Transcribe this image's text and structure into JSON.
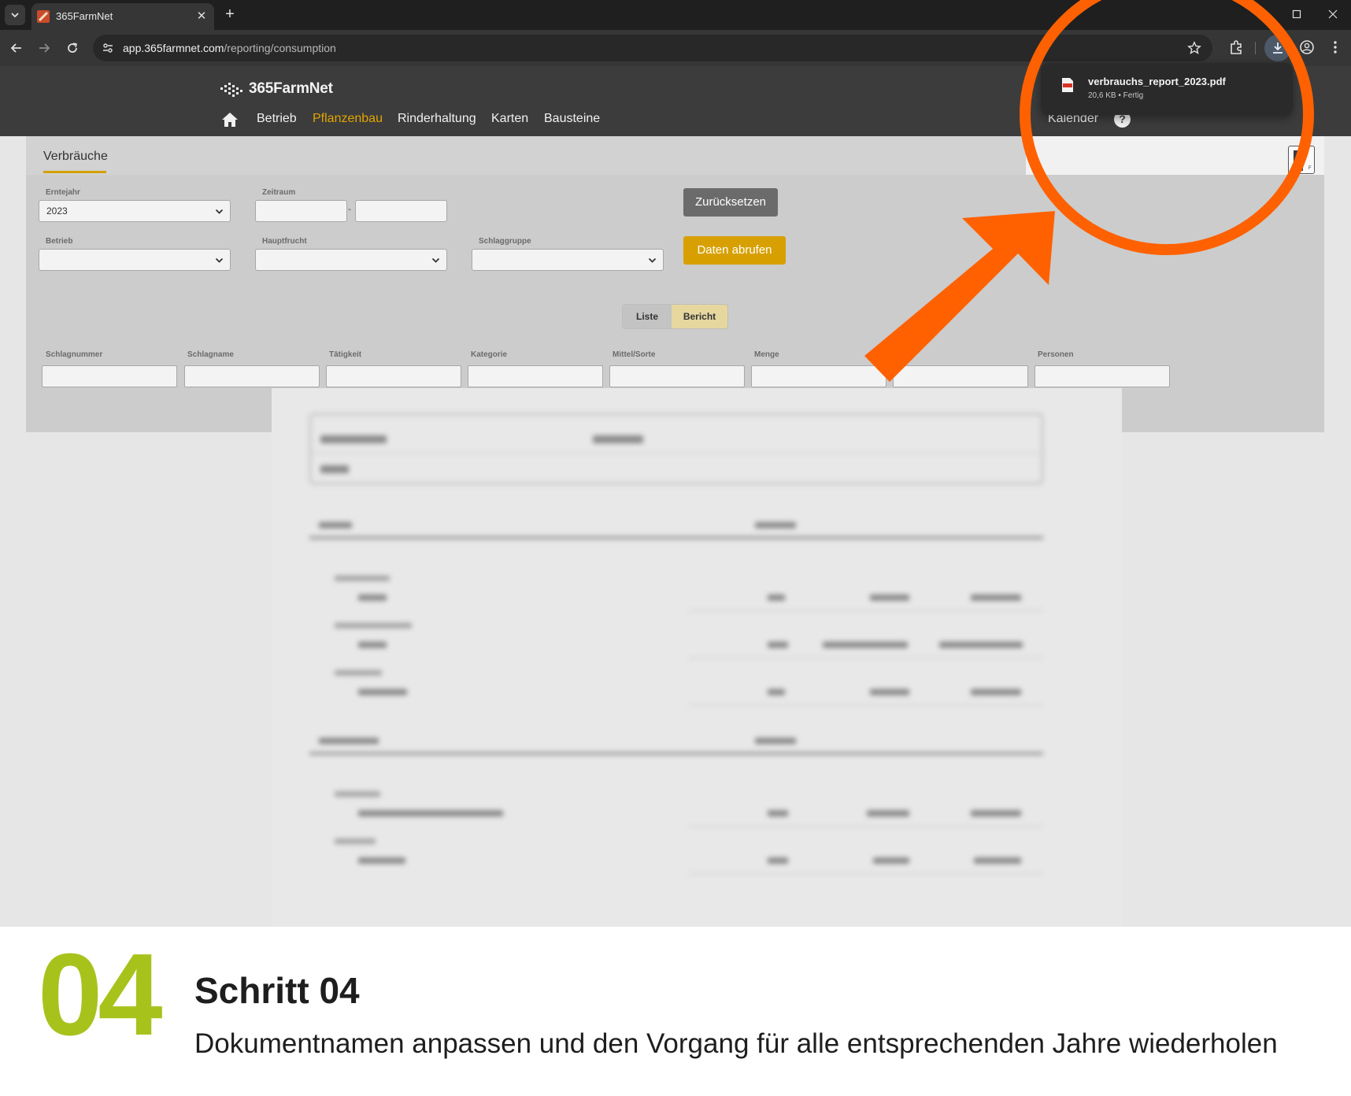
{
  "browser": {
    "tab_title": "365FarmNet",
    "new_tab_label": "+",
    "tab_close_label": "✕",
    "url_host": "app.365farmnet.com",
    "url_path": "/reporting/consumption"
  },
  "download": {
    "filename": "verbrauchs_report_2023.pdf",
    "meta": "20,6 KB • Fertig"
  },
  "header": {
    "logo_text": "365FarmNet",
    "nav": [
      {
        "label": "Betrieb",
        "active": false
      },
      {
        "label": "Pflanzenbau",
        "active": true
      },
      {
        "label": "Rinderhaltung",
        "active": false
      },
      {
        "label": "Karten",
        "active": false
      },
      {
        "label": "Bausteine",
        "active": false
      }
    ],
    "calendar_label": "Kalender",
    "help_label": "?"
  },
  "page": {
    "tab_label": "Verbräuche",
    "filters": {
      "erntejahr_label": "Erntejahr",
      "erntejahr_value": "2023",
      "zeitraum_label": "Zeitraum",
      "zeitraum_sep": "-",
      "betrieb_label": "Betrieb",
      "hauptfrucht_label": "Hauptfrucht",
      "schlaggruppe_label": "Schlaggruppe"
    },
    "buttons": {
      "reset": "Zurücksetzen",
      "fetch": "Daten abrufen"
    },
    "view_toggle": {
      "list": "Liste",
      "report": "Bericht"
    },
    "columns": [
      "Schlagnummer",
      "Schlagname",
      "Tätigkeit",
      "Kategorie",
      "Mittel/Sorte",
      "Menge",
      "",
      "Personen"
    ]
  },
  "caption": {
    "step_number": "04",
    "title": "Schritt 04",
    "description": "Dokumentnamen anpassen und den Vorgang für alle entsprechenden Jahre wiederholen"
  },
  "colors": {
    "accent_yellow": "#d7a000",
    "annotation_orange": "#ff6100",
    "step_green": "#a8c21c"
  }
}
